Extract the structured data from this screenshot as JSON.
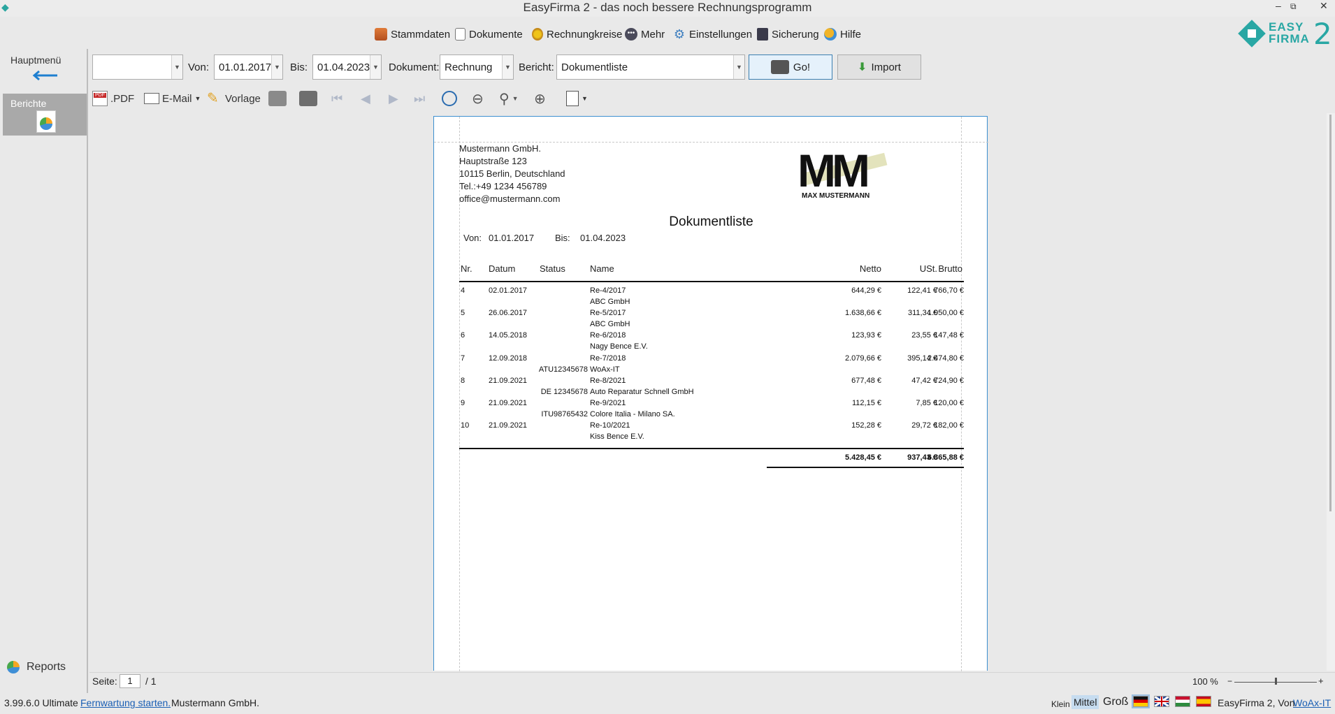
{
  "window": {
    "title": "EasyFirma 2 - das noch bessere Rechnungsprogramm",
    "minimize": "–",
    "restore": "⧉",
    "close": "✕"
  },
  "menu": {
    "items": [
      {
        "label": "Stammdaten",
        "icon": "cart-icon"
      },
      {
        "label": "Dokumente",
        "icon": "document-icon"
      },
      {
        "label": "Rechnungkreise",
        "icon": "coins-icon"
      },
      {
        "label": "Mehr",
        "icon": "more-icon"
      },
      {
        "label": "Einstellungen",
        "icon": "gears-icon"
      },
      {
        "label": "Sicherung",
        "icon": "floppy-icon"
      },
      {
        "label": "Hilfe",
        "icon": "help-icon"
      }
    ]
  },
  "logo": {
    "line1": "EASY",
    "line2": "FIRMA",
    "digit": "2"
  },
  "sidebar": {
    "hauptmenu": "Hauptmenü",
    "berichte": "Berichte",
    "reports": "Reports"
  },
  "filter": {
    "first_combo": "",
    "von_label": "Von:",
    "von_value": "01.01.2017",
    "bis_label": "Bis:",
    "bis_value": "01.04.2023",
    "dokument_label": "Dokument:",
    "dokument_value": "Rechnung",
    "bericht_label": "Bericht:",
    "bericht_value": "Dokumentliste",
    "go_label": "Go!",
    "import_label": "Import"
  },
  "toolbar": {
    "pdf_label": ".PDF",
    "email_label": "E-Mail",
    "vorlage_label": "Vorlage"
  },
  "report": {
    "company": "Mustermann GmbH.",
    "street": "Hauptstraße 123",
    "city": "10115 Berlin, Deutschland",
    "tel": "Tel.:+49 1234 456789",
    "email": "office@mustermann.com",
    "logo_letters": "MM",
    "logo_sub": "MAX MUSTERMANN",
    "title": "Dokumentliste",
    "von_label": "Von:",
    "von_value": "01.01.2017",
    "bis_label": "Bis:",
    "bis_value": "01.04.2023",
    "headers": {
      "nr": "Nr.",
      "datum": "Datum",
      "status": "Status",
      "name": "Name",
      "netto": "Netto",
      "ust": "USt.",
      "brutto": "Brutto"
    },
    "rows": [
      {
        "nr": "4",
        "datum": "02.01.2017",
        "status": "",
        "doc": "Re-4/2017",
        "customer": "ABC GmbH",
        "netto": "644,29 €",
        "ust": "122,41 €",
        "brutto": "766,70 €"
      },
      {
        "nr": "5",
        "datum": "26.06.2017",
        "status": "",
        "doc": "Re-5/2017",
        "customer": "ABC GmbH",
        "netto": "1.638,66 €",
        "ust": "311,34 €",
        "brutto": "1.950,00 €"
      },
      {
        "nr": "6",
        "datum": "14.05.2018",
        "status": "",
        "doc": "Re-6/2018",
        "customer": "Nagy Bence E.V.",
        "netto": "123,93 €",
        "ust": "23,55 €",
        "brutto": "147,48 €"
      },
      {
        "nr": "7",
        "datum": "12.09.2018",
        "status": "ATU12345678",
        "doc": "Re-7/2018",
        "customer": "WoAx-IT",
        "netto": "2.079,66 €",
        "ust": "395,14 €",
        "brutto": "2.474,80 €"
      },
      {
        "nr": "8",
        "datum": "21.09.2021",
        "status": "DE 12345678",
        "doc": "Re-8/2021",
        "customer": "Auto Reparatur Schnell GmbH",
        "netto": "677,48 €",
        "ust": "47,42 €",
        "brutto": "724,90 €"
      },
      {
        "nr": "9",
        "datum": "21.09.2021",
        "status": "ITU98765432",
        "doc": "Re-9/2021",
        "customer": "Colore Italia - Milano SA.",
        "netto": "112,15 €",
        "ust": "7,85 €",
        "brutto": "120,00 €"
      },
      {
        "nr": "10",
        "datum": "21.09.2021",
        "status": "",
        "doc": "Re-10/2021",
        "customer": "Kiss Bence E.V.",
        "netto": "152,28 €",
        "ust": "29,72 €",
        "brutto": "182,00 €"
      }
    ],
    "totals": {
      "netto": "5.428,45 €",
      "ust": "937,43 €",
      "brutto": "6.365,88 €"
    }
  },
  "pagebar": {
    "seite_label": "Seite:",
    "page": "1",
    "total": "/ 1",
    "zoom": "100 %",
    "zoom_fraction": 0.5
  },
  "status": {
    "version": "3.99.6.0 Ultimate",
    "remote": "Fernwartung starten.",
    "company": "Mustermann GmbH.",
    "size_small": "Klein",
    "size_medium": "Mittel",
    "size_large": "Groß",
    "credit": "EasyFirma 2, Von",
    "credit_link": "WoAx-IT"
  }
}
